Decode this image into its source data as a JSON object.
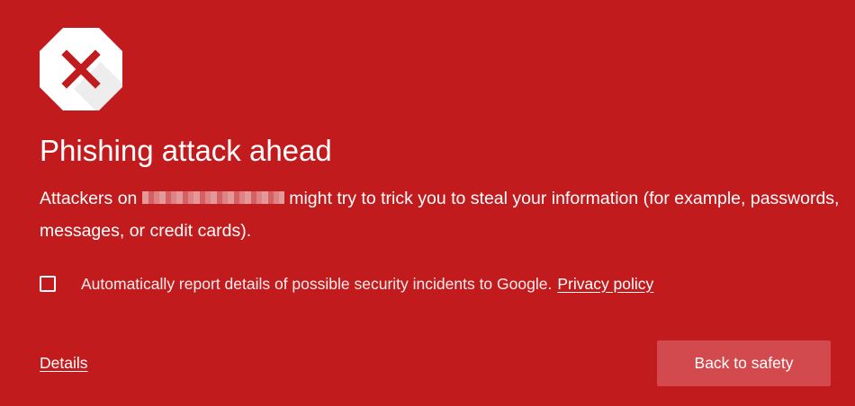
{
  "interstitial": {
    "icon": "error-octagon-x-icon",
    "title": "Phishing attack ahead",
    "message_before": "Attackers on",
    "message_after": "might try to trick you to steal your information (for example, passwords, messages, or credit cards).",
    "report_checkbox_checked": false,
    "report_label": "Automatically report details of possible security incidents to Google.",
    "privacy_link": "Privacy policy",
    "details_link": "Details",
    "back_button": "Back to safety"
  },
  "colors": {
    "background": "#c21b1e",
    "button_background": "#d24a4d",
    "icon_cross": "#c21b1e"
  }
}
